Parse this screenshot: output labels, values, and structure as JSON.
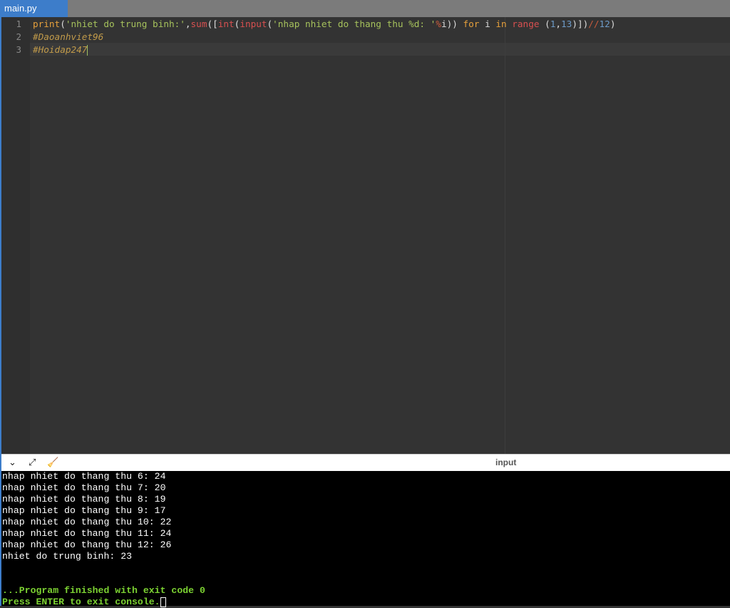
{
  "tab": {
    "label": "main.py"
  },
  "editor": {
    "line_numbers": [
      "1",
      "2",
      "3"
    ],
    "line1": {
      "t1": "print",
      "t2": "(",
      "t3": "'nhiet do trung binh:'",
      "t4": ",",
      "t5": "sum",
      "t6": "([",
      "t7": "int",
      "t8": "(",
      "t9": "input",
      "t10": "(",
      "t11": "'nhap nhiet do thang thu %d: '",
      "t12": "%",
      "t13": "i)) ",
      "t14": "for",
      "t15": " i ",
      "t16": "in",
      "t17": " ",
      "t18": "range",
      "t19": " (",
      "t20": "1",
      "t21": ",",
      "t22": "13",
      "t23": ")])",
      "t24": "//",
      "t25": "12",
      "t26": ")"
    },
    "line2": "#Daoanhviet96",
    "line3": "#Hoidap247"
  },
  "console_bar": {
    "input_label": "input"
  },
  "console": {
    "lines": [
      "nhap nhiet do thang thu 6: 24",
      "nhap nhiet do thang thu 7: 20",
      "nhap nhiet do thang thu 8: 19",
      "nhap nhiet do thang thu 9: 17",
      "nhap nhiet do thang thu 10: 22",
      "nhap nhiet do thang thu 11: 24",
      "nhap nhiet do thang thu 12: 26",
      "nhiet do trung binh: 23"
    ],
    "finished": "...Program finished with exit code 0",
    "press_enter": "Press ENTER to exit console."
  }
}
